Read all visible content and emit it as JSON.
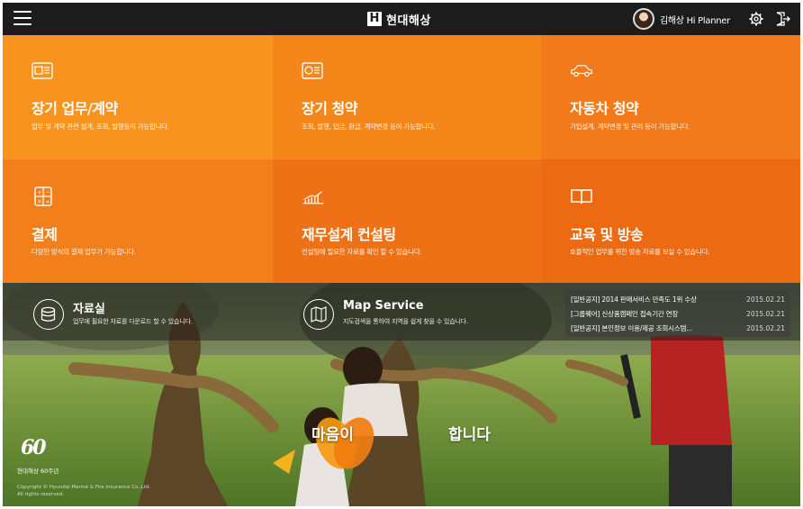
{
  "header": {
    "brand_mark": "H",
    "brand_name": "현대해상",
    "user_name": "김해상 Hi Planner"
  },
  "tiles": [
    {
      "title": "장기 업무/계약",
      "desc": "업무 및 계약 관련 설계, 조회, 발행등이 가능합니다.",
      "icon": "document-calculator-icon",
      "color": "#f7931e"
    },
    {
      "title": "장기 청약",
      "desc": "조회, 발행, 입금, 환급, 계약변경 등이 가능합니다.",
      "icon": "contract-icon",
      "color": "#f4861a"
    },
    {
      "title": "자동차 청약",
      "desc": "가입설계, 계약변경 및 관리 등이 가능합니다.",
      "icon": "car-icon",
      "color": "#f37a1a"
    },
    {
      "title": "결제",
      "desc": "다양한 방식의 결제 업무가 가능합니다.",
      "icon": "calculator-icon",
      "color": "#f27f1c"
    },
    {
      "title": "재무설계 컨설팅",
      "desc": "컨설팅에 필요한 자료를 확인 할 수 있습니다.",
      "icon": "chart-growth-icon",
      "color": "#ef7116"
    },
    {
      "title": "교육 및 방송",
      "desc": "효율적인 업무를 위한 방송 자료를 보실 수 있습니다.",
      "icon": "book-icon",
      "color": "#ec6a12"
    }
  ],
  "photo_links": [
    {
      "title": "자료실",
      "desc": "업무에 필요한 자료를 다운로드 할 수 있습니다.",
      "icon": "database-icon"
    },
    {
      "title": "Map Service",
      "desc": "지도검색을 통하여 지역을 쉽게 찾을 수 있습니다.",
      "icon": "map-icon"
    }
  ],
  "notices": [
    {
      "title": "[일반공지] 2014 판매서비스 만족도 1위 수상",
      "date": "2015.02.21"
    },
    {
      "title": "[그룹웨어] 신상품캠페인 접속기간 연장",
      "date": "2015.02.21"
    },
    {
      "title": "[일반공지] 본인정보 이용/제공 조회시스템...",
      "date": "2015.02.21"
    }
  ],
  "slogan": {
    "left": "마음이",
    "right": "합니다"
  },
  "anniversary": {
    "logo": "60",
    "text": "현대해상 60주년"
  },
  "copyright": {
    "line1": "Copyright © Hyundai Marine & Fire Insurance Co.,Ltd.",
    "line2": "All rights reserved."
  }
}
